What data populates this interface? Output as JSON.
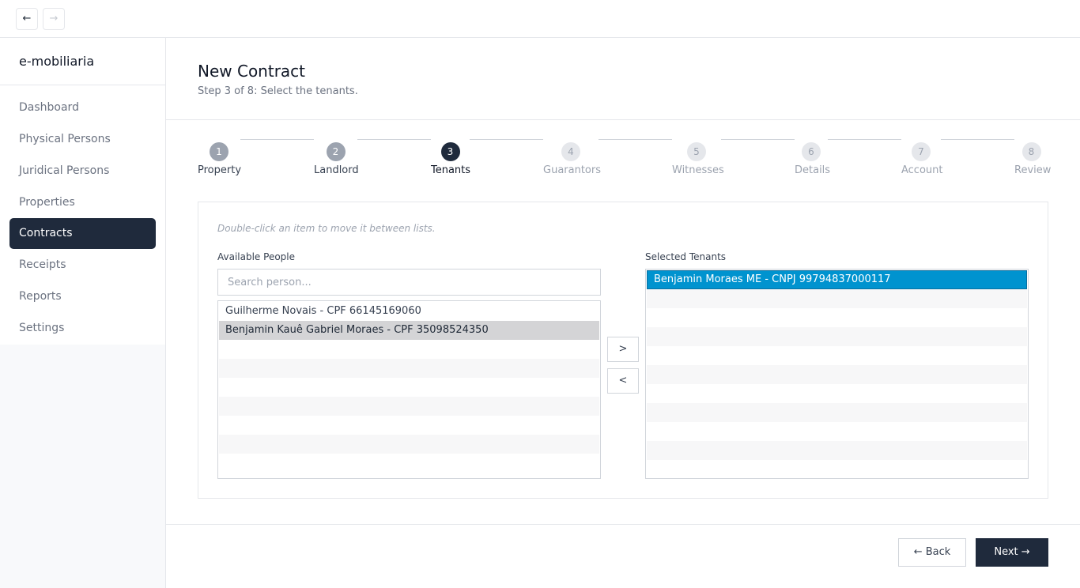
{
  "nav": {
    "back_icon": "←",
    "forward_icon": "→"
  },
  "sidebar": {
    "brand": "e-mobiliaria",
    "items": [
      {
        "label": "Dashboard",
        "active": false
      },
      {
        "label": "Physical Persons",
        "active": false
      },
      {
        "label": "Juridical Persons",
        "active": false
      },
      {
        "label": "Properties",
        "active": false
      },
      {
        "label": "Contracts",
        "active": true
      },
      {
        "label": "Receipts",
        "active": false
      },
      {
        "label": "Reports",
        "active": false
      },
      {
        "label": "Settings",
        "active": false
      }
    ]
  },
  "header": {
    "title": "New Contract",
    "subtitle": "Step 3 of 8: Select the tenants."
  },
  "stepper": {
    "current_step": 3,
    "steps": [
      {
        "number": "1",
        "label": "Property",
        "state": "done"
      },
      {
        "number": "2",
        "label": "Landlord",
        "state": "done"
      },
      {
        "number": "3",
        "label": "Tenants",
        "state": "current"
      },
      {
        "number": "4",
        "label": "Guarantors",
        "state": "todo"
      },
      {
        "number": "5",
        "label": "Witnesses",
        "state": "todo"
      },
      {
        "number": "6",
        "label": "Details",
        "state": "todo"
      },
      {
        "number": "7",
        "label": "Account",
        "state": "todo"
      },
      {
        "number": "8",
        "label": "Review",
        "state": "todo"
      }
    ]
  },
  "panel": {
    "hint": "Double-click an item to move it between lists.",
    "available": {
      "label": "Available People",
      "search_placeholder": "Search person...",
      "items": [
        {
          "text": "Guilherme Novais - CPF 66145169060",
          "selected": false
        },
        {
          "text": "Benjamin Kauê Gabriel Moraes - CPF 35098524350",
          "selected": true
        }
      ]
    },
    "selected": {
      "label": "Selected Tenants",
      "items": [
        {
          "text": "Benjamin Moraes ME - CNPJ 99794837000117",
          "selected": true
        }
      ]
    },
    "move_right_label": ">",
    "move_left_label": "<"
  },
  "footer": {
    "back_label": "← Back",
    "next_label": "Next →"
  },
  "colors": {
    "accent_dark": "#1f2a3c",
    "selection_blue": "#0093cf"
  }
}
